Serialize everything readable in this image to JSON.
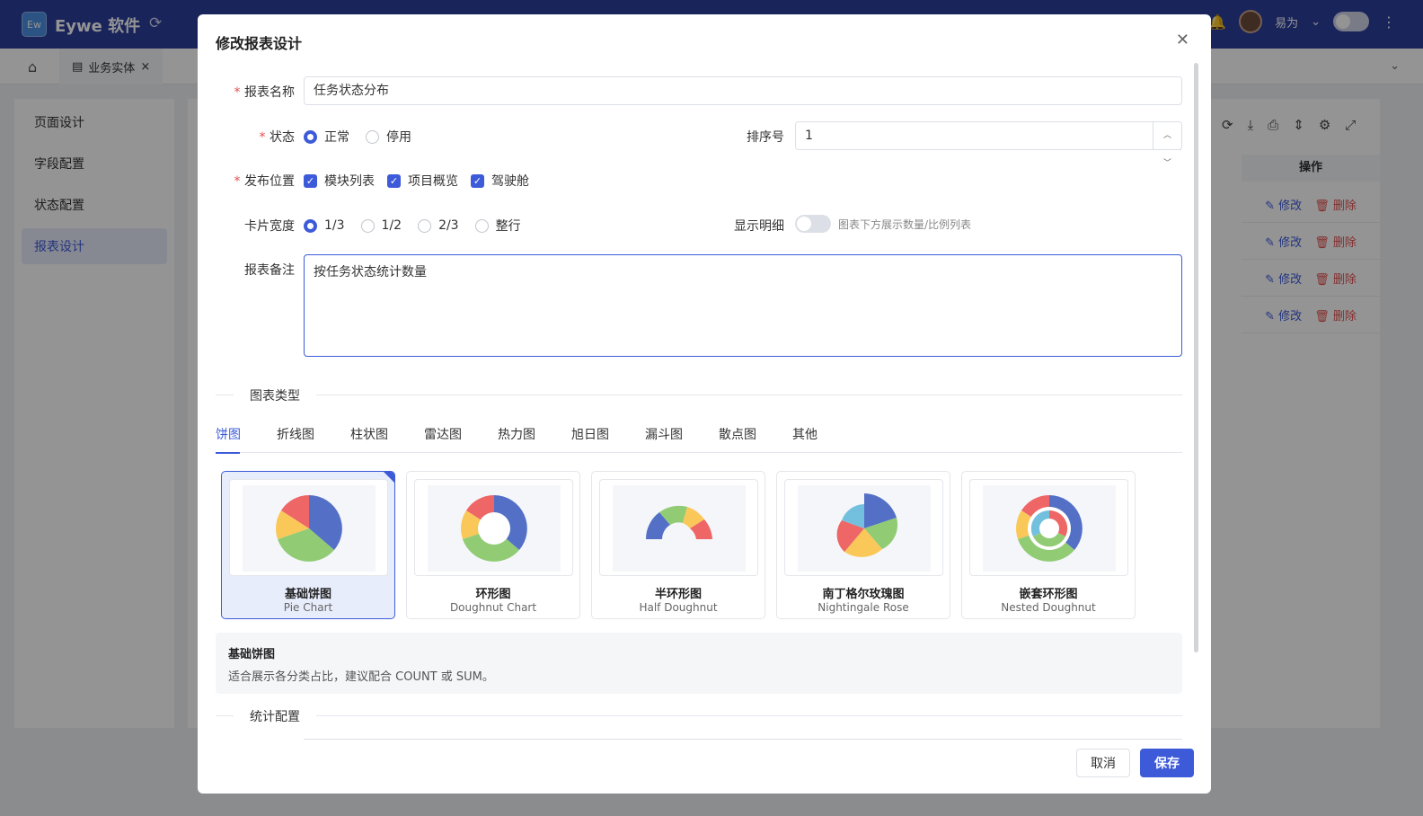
{
  "app": {
    "logo_text": "Ew",
    "brand": "Eywe 软件",
    "user_name": "易为",
    "user_caret": "⌄"
  },
  "tabs": {
    "entity_tab": "业务实体",
    "entity_close": "×"
  },
  "sidebar": {
    "items": [
      {
        "label": "页面设计",
        "active": false
      },
      {
        "label": "字段配置",
        "active": false
      },
      {
        "label": "状态配置",
        "active": false
      },
      {
        "label": "报表设计",
        "active": true
      }
    ]
  },
  "table": {
    "op_header": "操作",
    "edit_label": "修改",
    "delete_label": "删除"
  },
  "modal": {
    "title": "修改报表设计",
    "name_label": "报表名称",
    "name_value": "任务状态分布",
    "status_label": "状态",
    "status_options": [
      "正常",
      "停用"
    ],
    "status_selected": "正常",
    "sort_label": "排序号",
    "sort_value": "1",
    "publish_label": "发布位置",
    "publish_options": [
      "模块列表",
      "项目概览",
      "驾驶舱"
    ],
    "width_label": "卡片宽度",
    "width_options": [
      "1/3",
      "1/2",
      "2/3",
      "整行"
    ],
    "width_selected": "1/3",
    "detail_label": "显示明细",
    "detail_hint": "图表下方展示数量/比例列表",
    "remark_label": "报表备注",
    "remark_value": "按任务状态统计数量",
    "chart_type_section": "图表类型",
    "chart_tabs": [
      "饼图",
      "折线图",
      "柱状图",
      "雷达图",
      "热力图",
      "旭日图",
      "漏斗图",
      "散点图",
      "其他"
    ],
    "chart_tab_active": "饼图",
    "cards": [
      {
        "name": "基础饼图",
        "en": "Pie Chart",
        "selected": true
      },
      {
        "name": "环形图",
        "en": "Doughnut Chart",
        "selected": false
      },
      {
        "name": "半环形图",
        "en": "Half Doughnut",
        "selected": false
      },
      {
        "name": "南丁格尔玫瑰图",
        "en": "Nightingale Rose",
        "selected": false
      },
      {
        "name": "嵌套环形图",
        "en": "Nested Doughnut",
        "selected": false
      }
    ],
    "desc_title": "基础饼图",
    "desc_text": "适合展示各分类占比，建议配合 COUNT 或 SUM。",
    "stats_section": "统计配置",
    "cancel_label": "取消",
    "save_label": "保存"
  },
  "colors": {
    "primary": "#3d5bd9",
    "danger": "#e55050",
    "blue": "#5470c6",
    "green": "#91cc75",
    "yellow": "#fac858",
    "red": "#ee6666",
    "cyan": "#73c0de"
  }
}
